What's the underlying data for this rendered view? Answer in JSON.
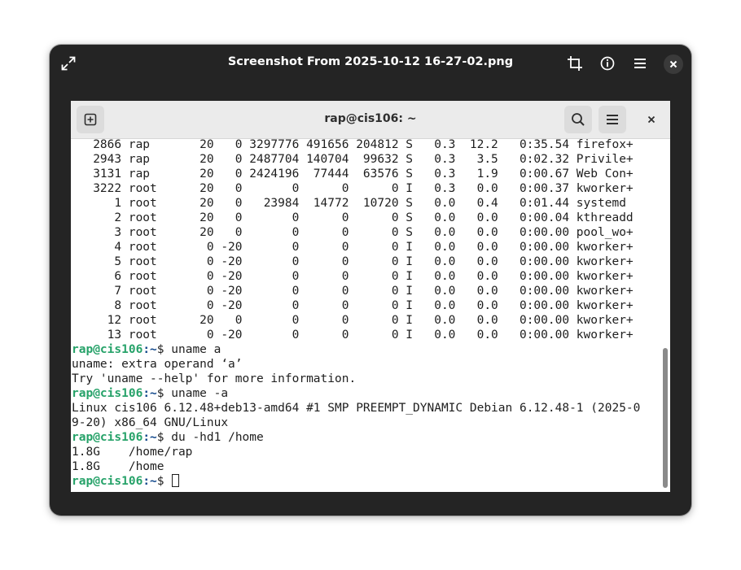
{
  "viewer": {
    "title": "Screenshot From 2025-10-12 16-27-02.png",
    "icons": [
      "fullscreen-icon",
      "crop-icon",
      "info-icon",
      "menu-icon",
      "close-icon"
    ]
  },
  "terminal": {
    "title": "rap@cis106: ~",
    "icons": [
      "new-tab-icon",
      "search-icon",
      "menu-icon",
      "close-icon"
    ],
    "process_rows": [
      "   2866 rap       20   0 3297776 491656 204812 S   0.3  12.2   0:35.54 firefox+",
      "   2943 rap       20   0 2487704 140704  99632 S   0.3   3.5   0:02.32 Privile+",
      "   3131 rap       20   0 2424196  77444  63576 S   0.3   1.9   0:00.67 Web Con+",
      "   3222 root      20   0       0      0      0 I   0.3   0.0   0:00.37 kworker+",
      "      1 root      20   0   23984  14772  10720 S   0.0   0.4   0:01.44 systemd",
      "      2 root      20   0       0      0      0 S   0.0   0.0   0:00.04 kthreadd",
      "      3 root      20   0       0      0      0 S   0.0   0.0   0:00.00 pool_wo+",
      "      4 root       0 -20       0      0      0 I   0.0   0.0   0:00.00 kworker+",
      "      5 root       0 -20       0      0      0 I   0.0   0.0   0:00.00 kworker+",
      "      6 root       0 -20       0      0      0 I   0.0   0.0   0:00.00 kworker+",
      "      7 root       0 -20       0      0      0 I   0.0   0.0   0:00.00 kworker+",
      "      8 root       0 -20       0      0      0 I   0.0   0.0   0:00.00 kworker+",
      "     12 root      20   0       0      0      0 I   0.0   0.0   0:00.00 kworker+",
      "     13 root       0 -20       0      0      0 I   0.0   0.0   0:00.00 kworker+"
    ],
    "prompt_user": "rap@cis106",
    "prompt_path": ":~",
    "prompt_symbol": "$ ",
    "session": {
      "cmd1": "uname a",
      "out1_line1": "uname: extra operand ‘a’",
      "out1_line2": "Try 'uname --help' for more information.",
      "cmd2": "uname -a",
      "out2_line1": "Linux cis106 6.12.48+deb13-amd64 #1 SMP PREEMPT_DYNAMIC Debian 6.12.48-1 (2025-0",
      "out2_line2": "9-20) x86_64 GNU/Linux",
      "cmd3": "du -hd1 /home",
      "out3_line1": "1.8G    /home/rap",
      "out3_line2": "1.8G    /home",
      "cmd4": ""
    }
  }
}
